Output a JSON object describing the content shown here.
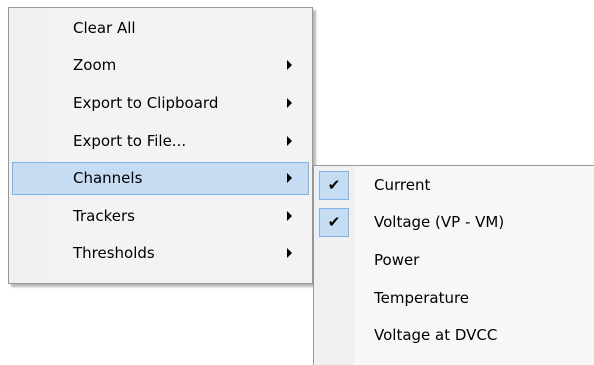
{
  "context_menu": {
    "items": [
      {
        "label": "Clear All",
        "has_submenu": false
      },
      {
        "label": "Zoom",
        "has_submenu": true
      },
      {
        "label": "Export to Clipboard",
        "has_submenu": true
      },
      {
        "label": "Export to File...",
        "has_submenu": true
      },
      {
        "label": "Channels",
        "has_submenu": true,
        "highlighted": true
      },
      {
        "label": "Trackers",
        "has_submenu": true
      },
      {
        "label": "Thresholds",
        "has_submenu": true
      }
    ]
  },
  "channels_submenu": {
    "items": [
      {
        "label": "Current",
        "checked": true
      },
      {
        "label": "Voltage (VP - VM)",
        "checked": true
      },
      {
        "label": "Power",
        "checked": false
      },
      {
        "label": "Temperature",
        "checked": false
      },
      {
        "label": "Voltage at DVCC",
        "checked": false
      }
    ],
    "check_glyph": "✔"
  },
  "colors": {
    "menu_background": "#f3f3f3",
    "highlight": "#c6dcf3",
    "highlight_border": "#7fb2ea",
    "menu_border": "#979797"
  }
}
